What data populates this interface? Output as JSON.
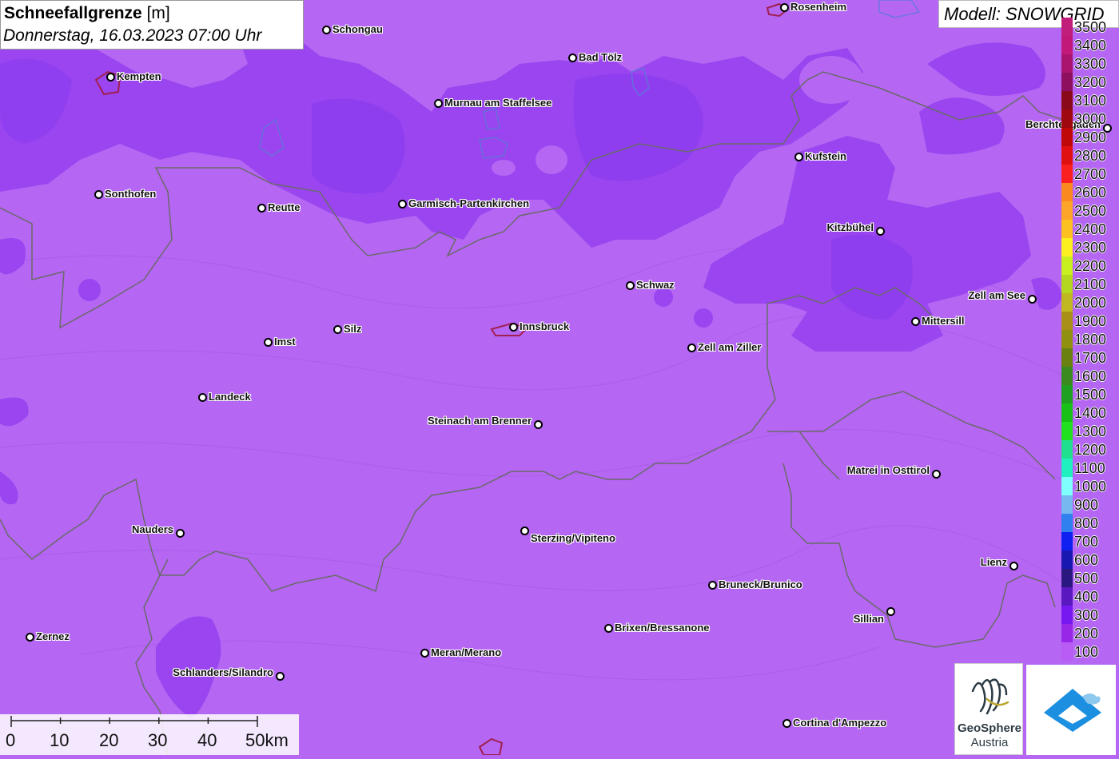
{
  "title": {
    "bold": "Schneefallgrenze",
    "unit": "[m]",
    "date": "Donnerstag, 16.03.2023 07:00 Uhr"
  },
  "model": "Modell: SNOWGRID",
  "colors": {
    "background": "#b566f3",
    "snow_zone": "#9a45ef",
    "snow_core": "#8a3cf0"
  },
  "cities": [
    {
      "name": "Rosenheim"
    },
    {
      "name": "Schongau"
    },
    {
      "name": "Bad Tölz"
    },
    {
      "name": "Kempten"
    },
    {
      "name": "Murnau am Staffelsee"
    },
    {
      "name": "Berchtesgaden"
    },
    {
      "name": "Kufstein"
    },
    {
      "name": "Sonthofen"
    },
    {
      "name": "Reutte"
    },
    {
      "name": "Garmisch-Partenkirchen"
    },
    {
      "name": "Kitzbühel"
    },
    {
      "name": "Schwaz"
    },
    {
      "name": "Zell am See"
    },
    {
      "name": "Mittersill"
    },
    {
      "name": "Silz"
    },
    {
      "name": "Innsbruck"
    },
    {
      "name": "Imst"
    },
    {
      "name": "Zell am Ziller"
    },
    {
      "name": "Landeck"
    },
    {
      "name": "Steinach am Brenner"
    },
    {
      "name": "Matrei in Osttirol"
    },
    {
      "name": "Nauders"
    },
    {
      "name": "Sterzing/Vipiteno"
    },
    {
      "name": "Lienz"
    },
    {
      "name": "Bruneck/Brunico"
    },
    {
      "name": "Sillian"
    },
    {
      "name": "Zernez"
    },
    {
      "name": "Brixen/Bressanone"
    },
    {
      "name": "Meran/Merano"
    },
    {
      "name": "Schlanders/Silandro"
    },
    {
      "name": "Cortina d'Ampezzo"
    }
  ],
  "legend": [
    {
      "label": "3500",
      "color": "#c01e7a"
    },
    {
      "label": "3400",
      "color": "#c2187a"
    },
    {
      "label": "3300",
      "color": "#a8146e"
    },
    {
      "label": "3200",
      "color": "#8e0f5e"
    },
    {
      "label": "3100",
      "color": "#8a0a1c"
    },
    {
      "label": "3000",
      "color": "#a00810"
    },
    {
      "label": "2900",
      "color": "#c00808"
    },
    {
      "label": "2800",
      "color": "#e01010"
    },
    {
      "label": "2700",
      "color": "#fa2020"
    },
    {
      "label": "2600",
      "color": "#fa8a20"
    },
    {
      "label": "2500",
      "color": "#fca528"
    },
    {
      "label": "2400",
      "color": "#fcc020"
    },
    {
      "label": "2300",
      "color": "#fcf020"
    },
    {
      "label": "2200",
      "color": "#c8f020"
    },
    {
      "label": "2100",
      "color": "#b4d820"
    },
    {
      "label": "2000",
      "color": "#c0b820"
    },
    {
      "label": "1900",
      "color": "#a89018"
    },
    {
      "label": "1800",
      "color": "#909010"
    },
    {
      "label": "1700",
      "color": "#6a8010"
    },
    {
      "label": "1600",
      "color": "#3a8a20"
    },
    {
      "label": "1500",
      "color": "#20a020"
    },
    {
      "label": "1400",
      "color": "#18c018"
    },
    {
      "label": "1300",
      "color": "#20e020"
    },
    {
      "label": "1200",
      "color": "#20e090"
    },
    {
      "label": "1100",
      "color": "#20f0c0"
    },
    {
      "label": "1000",
      "color": "#80ffff"
    },
    {
      "label": "900",
      "color": "#78b8f0"
    },
    {
      "label": "800",
      "color": "#3080f0"
    },
    {
      "label": "700",
      "color": "#1020f0"
    },
    {
      "label": "600",
      "color": "#1818b0"
    },
    {
      "label": "500",
      "color": "#2a1880"
    },
    {
      "label": "400",
      "color": "#5a18c0"
    },
    {
      "label": "300",
      "color": "#7818f0"
    },
    {
      "label": "200",
      "color": "#9828e8"
    },
    {
      "label": "100",
      "color": "#b85cf5"
    }
  ],
  "scale": {
    "ticks": [
      "0",
      "10",
      "20",
      "30",
      "40",
      "50km"
    ]
  },
  "logos": {
    "geosphere_line1": "GeoSphere",
    "geosphere_line2": "Austria"
  }
}
